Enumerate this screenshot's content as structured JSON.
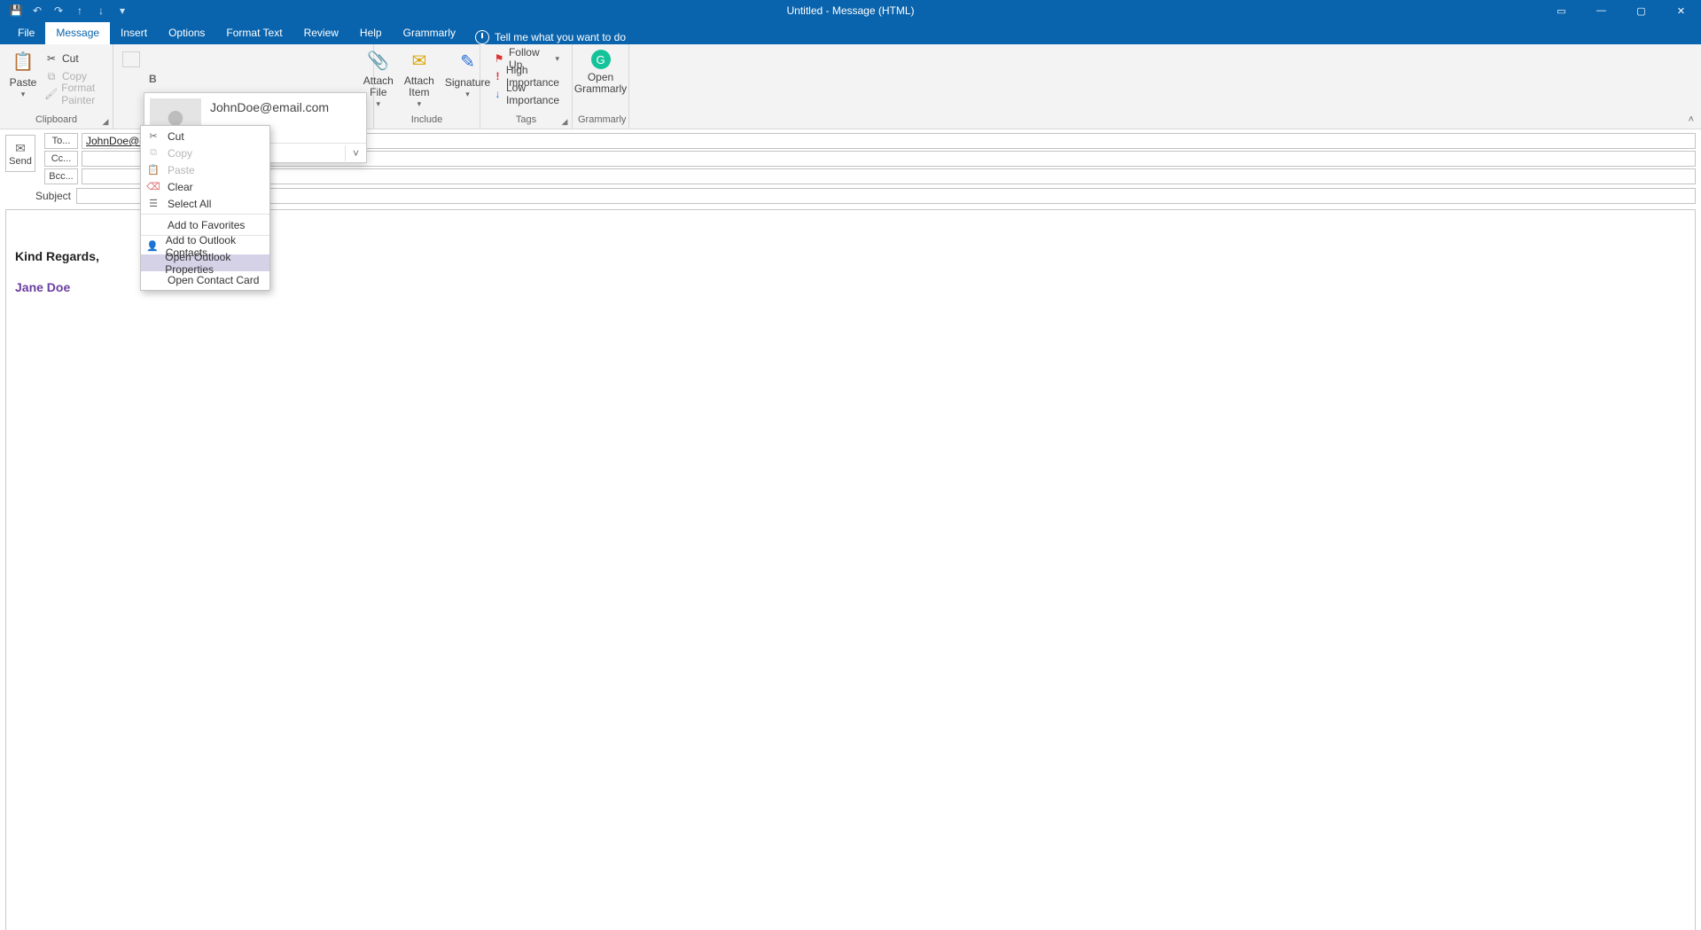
{
  "window": {
    "title": "Untitled  -  Message (HTML)"
  },
  "qat": {
    "save": "💾",
    "undo": "↶",
    "redo": "↷",
    "prev": "↑",
    "next": "↓",
    "more": "▾"
  },
  "winbuttons": {
    "display_opts": "▭",
    "min": "—",
    "max": "▢",
    "close": "✕"
  },
  "tabs": {
    "file": "File",
    "message": "Message",
    "insert": "Insert",
    "options": "Options",
    "format_text": "Format Text",
    "review": "Review",
    "help": "Help",
    "grammarly": "Grammarly",
    "tell_me": "Tell me what you want to do"
  },
  "ribbon": {
    "clipboard": {
      "label": "Clipboard",
      "paste": "Paste",
      "cut": "Cut",
      "copy": "Copy",
      "format_painter": "Format Painter"
    },
    "basic_text": {
      "bold": "B"
    },
    "include": {
      "label": "Include",
      "attach_file": "Attach File",
      "attach_item": "Attach Item",
      "signature": "Signature"
    },
    "tags": {
      "label": "Tags",
      "follow_up": "Follow Up",
      "high_importance": "High Importance",
      "low_importance": "Low Importance"
    },
    "grammarly": {
      "label": "Grammarly",
      "open": "Open Grammarly"
    },
    "collapse": "˄"
  },
  "contact_card": {
    "name": "JohnDoe@email.com"
  },
  "address": {
    "send": "Send",
    "to_label": "To...",
    "cc_label": "Cc...",
    "bcc_label": "Bcc...",
    "subject_label": "Subject",
    "to_value": "JohnDoe@email.com",
    "cc_value": "",
    "bcc_value": "",
    "subject_value": ""
  },
  "body": {
    "regards": "Kind Regards,",
    "signature_name": "Jane Doe"
  },
  "context_menu": {
    "cut": "Cut",
    "copy": "Copy",
    "paste": "Paste",
    "clear": "Clear",
    "select_all": "Select All",
    "add_favorites": "Add to Favorites",
    "add_contacts": "Add to Outlook Contacts",
    "open_properties": "Open Outlook Properties",
    "open_contact_card": "Open Contact Card"
  }
}
